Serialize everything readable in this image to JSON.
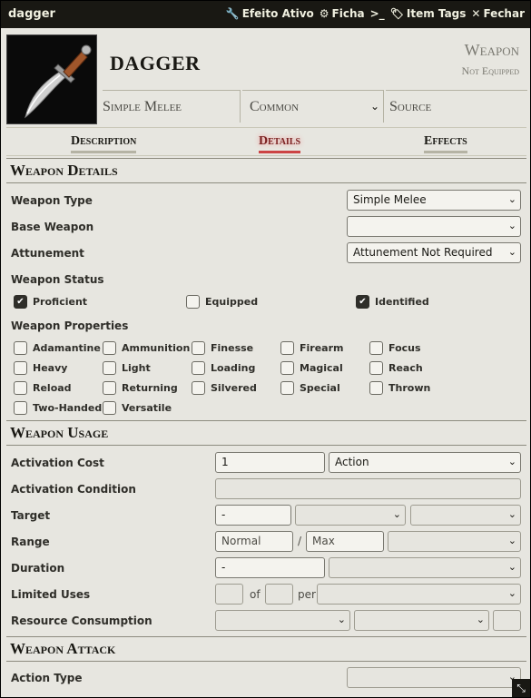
{
  "window": {
    "title": "dagger",
    "actions": [
      {
        "icon": "wrench-icon",
        "label": "Efeito Ativo"
      },
      {
        "icon": "gear-icon",
        "label": "Ficha"
      },
      {
        "icon": "terminal-icon",
        "label": ""
      },
      {
        "icon": "tags-icon",
        "label": "Item Tags"
      },
      {
        "icon": "close-icon",
        "label": "Fechar"
      }
    ]
  },
  "item": {
    "name": "DAGGER",
    "type": "Weapon",
    "status": "Not Equipped",
    "summary": {
      "subtype": "Simple Melee",
      "rarity": "Common",
      "source": "Source"
    }
  },
  "tabs": [
    {
      "label": "Description",
      "active": false
    },
    {
      "label": "Details",
      "active": true
    },
    {
      "label": "Effects",
      "active": false
    }
  ],
  "details": {
    "header": "Weapon Details",
    "weapon_type_label": "Weapon Type",
    "weapon_type_value": "Simple Melee",
    "base_weapon_label": "Base Weapon",
    "base_weapon_value": "",
    "attunement_label": "Attunement",
    "attunement_value": "Attunement Not Required",
    "status_label": "Weapon Status",
    "status": [
      {
        "label": "Proficient",
        "checked": true
      },
      {
        "label": "Equipped",
        "checked": false
      },
      {
        "label": "Identified",
        "checked": true
      }
    ],
    "properties_label": "Weapon Properties",
    "properties": [
      "Adamantine",
      "Ammunition",
      "Finesse",
      "Firearm",
      "Focus",
      "Heavy",
      "Light",
      "Loading",
      "Magical",
      "Reach",
      "Reload",
      "Returning",
      "Silvered",
      "Special",
      "Thrown",
      "Two-Handed",
      "Versatile"
    ]
  },
  "usage": {
    "header": "Weapon Usage",
    "activation_cost_label": "Activation Cost",
    "activation_cost_value": "1",
    "activation_type": "Action",
    "activation_condition_label": "Activation Condition",
    "target_label": "Target",
    "target_value": "-",
    "range_label": "Range",
    "range_normal": "Normal",
    "range_sep": "/",
    "range_max": "Max",
    "duration_label": "Duration",
    "duration_value": "-",
    "limited_uses_label": "Limited Uses",
    "of_label": "of",
    "per_label": "per",
    "resource_label": "Resource Consumption"
  },
  "attack": {
    "header": "Weapon Attack",
    "action_type_label": "Action Type"
  }
}
